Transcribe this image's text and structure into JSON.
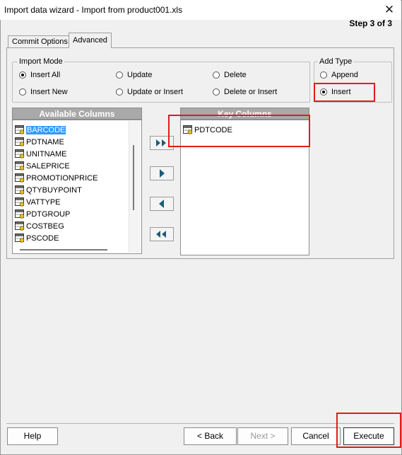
{
  "window": {
    "title": "Import data wizard - Import from product001.xls",
    "close_glyph": "✕"
  },
  "step_label": "Step 3 of 3",
  "tabs": [
    {
      "label": "Commit Options"
    },
    {
      "label": "Advanced"
    }
  ],
  "import_mode": {
    "label": "Import Mode",
    "options": [
      {
        "label": "Insert All",
        "selected": true
      },
      {
        "label": "Update",
        "selected": false
      },
      {
        "label": "Delete",
        "selected": false
      },
      {
        "label": "Insert New",
        "selected": false
      },
      {
        "label": "Update or Insert",
        "selected": false
      },
      {
        "label": "Delete or Insert",
        "selected": false
      }
    ]
  },
  "add_type": {
    "label": "Add Type",
    "options": [
      {
        "label": "Append",
        "selected": false
      },
      {
        "label": "Insert",
        "selected": true
      }
    ]
  },
  "available_columns": {
    "header": "Available Columns",
    "items": [
      "BARCODE",
      "PDTNAME",
      "UNITNAME",
      "SALEPRICE",
      "PROMOTIONPRICE",
      "QTYBUYPOINT",
      "VATTYPE",
      "PDTGROUP",
      "COSTBEG",
      "PSCODE"
    ],
    "selected": "BARCODE"
  },
  "key_columns": {
    "header": "Key Columns",
    "items": [
      "PDTCODE"
    ]
  },
  "transfer_buttons": [
    {
      "name": "move-all-right",
      "icon": "double-right-arrow-icon"
    },
    {
      "name": "move-right",
      "icon": "right-arrow-icon"
    },
    {
      "name": "move-left",
      "icon": "left-arrow-icon"
    },
    {
      "name": "move-all-left",
      "icon": "double-left-arrow-icon"
    }
  ],
  "buttons": {
    "help": "Help",
    "back": "< Back",
    "next": "Next >",
    "cancel": "Cancel",
    "execute": "Execute"
  },
  "colors": {
    "highlight": "#e31b1b",
    "selection": "#3399ff",
    "list_header": "#a9a9a9"
  }
}
